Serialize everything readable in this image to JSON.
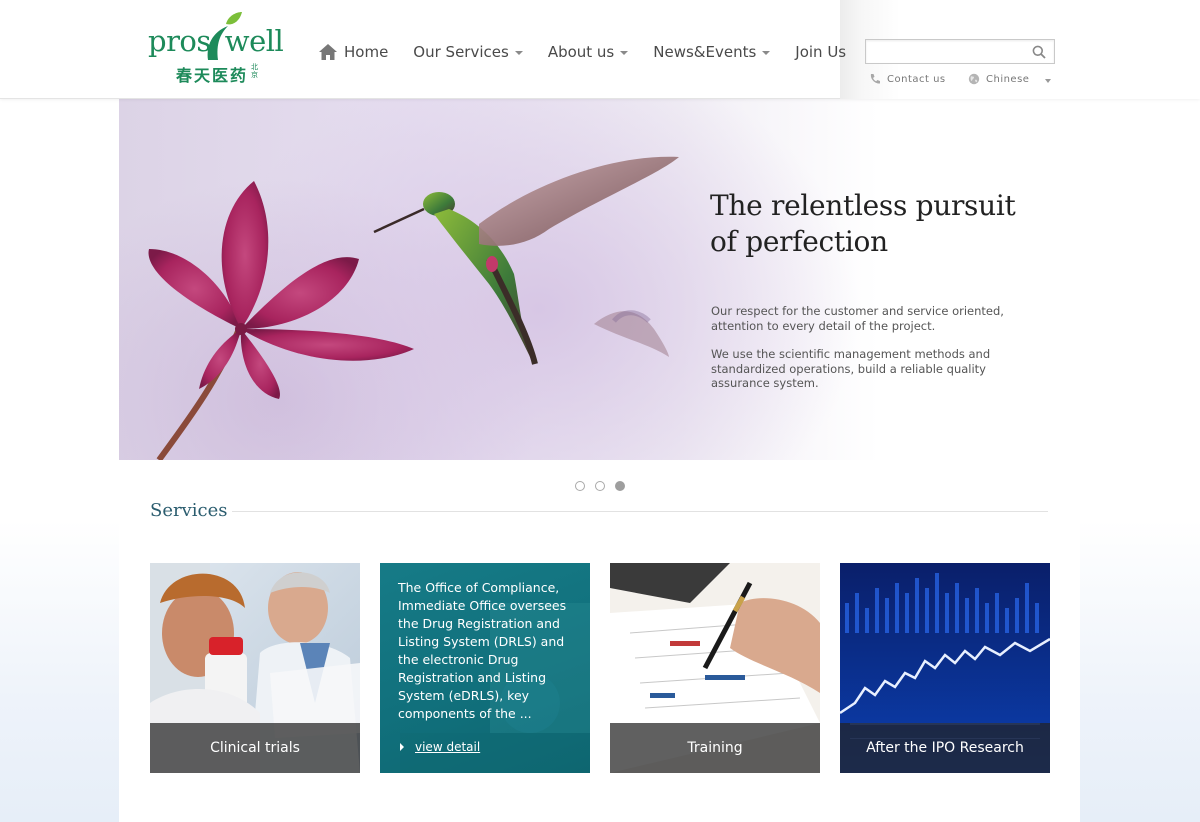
{
  "header": {
    "logo": {
      "en_left": "pros",
      "en_right": "well",
      "cn": "春天医药",
      "cn_small": "北京"
    },
    "nav": [
      {
        "label": "Home",
        "icon": "home-icon",
        "dropdown": false
      },
      {
        "label": "Our Services",
        "dropdown": true
      },
      {
        "label": "About us",
        "dropdown": true
      },
      {
        "label": "News&Events",
        "dropdown": true
      },
      {
        "label": "Join Us",
        "dropdown": false
      }
    ],
    "search": {
      "placeholder": "",
      "icon": "search-icon"
    },
    "contact_label": "Contact us",
    "language_label": "Chinese"
  },
  "hero": {
    "title": "The relentless pursuit of perfection",
    "paragraph1": "Our respect for the customer and service oriented, attention to every detail of the project.",
    "paragraph2": "We use the scientific management methods and standardized operations, build a reliable quality assurance system.",
    "slides": 3,
    "active_slide": 3
  },
  "services": {
    "title": "Services",
    "cards": [
      {
        "caption": "Clinical trials"
      },
      {
        "description": "The Office of Compliance, Immediate Office oversees the Drug Registration and Listing System (DRLS) and the electronic Drug Registration and Listing System (eDRLS), key components of the ...",
        "link": "view detail"
      },
      {
        "caption": "Training"
      },
      {
        "caption": "After the IPO Research"
      }
    ]
  },
  "colors": {
    "brand_green": "#1d8a5a",
    "teal_card": "#157884",
    "title_blue": "#2a5c6e"
  }
}
